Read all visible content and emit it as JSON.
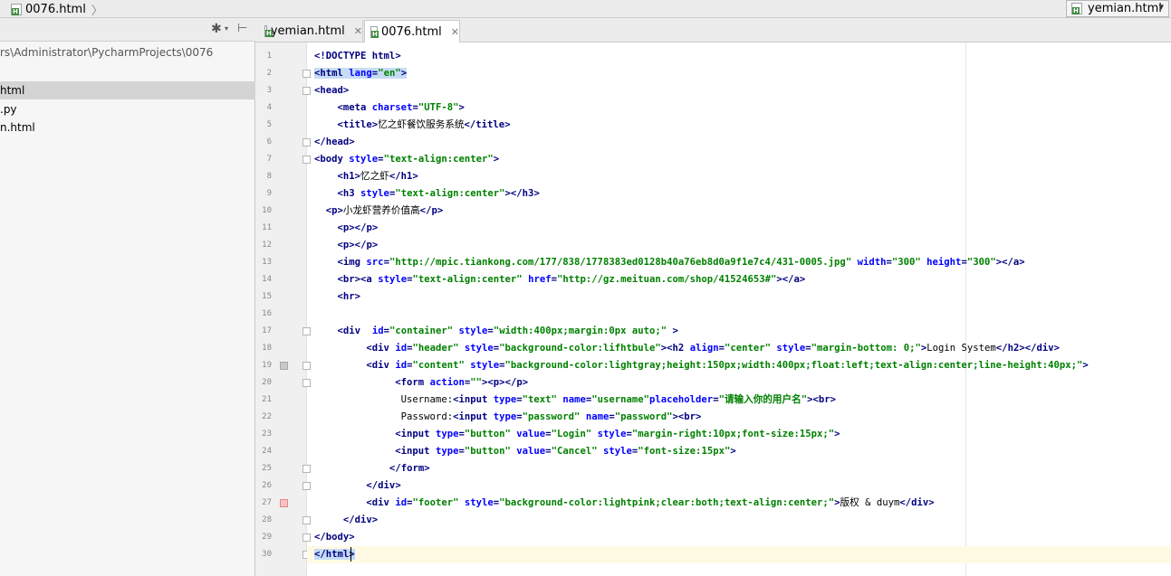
{
  "navbar": {
    "current_file": "0076.html",
    "run_config": "yemian.html"
  },
  "project": {
    "path": "rs\\Administrator\\PycharmProjects\\0076",
    "items": [
      {
        "label": "html",
        "selected": true
      },
      {
        "label": ".py",
        "selected": false
      },
      {
        "label": "n.html",
        "selected": false
      }
    ]
  },
  "tabs": [
    {
      "label": "yemian.html",
      "active": false
    },
    {
      "label": "0076.html",
      "active": true
    }
  ],
  "colors": {
    "tag": "#000080",
    "attr": "#0000ff",
    "string": "#008000",
    "current_line": "#fffae3",
    "match_highlight": "#c6dcf5"
  },
  "code": [
    {
      "n": "1",
      "text": "<!DOCTYPE html>"
    },
    {
      "n": "2",
      "text": "<html lang=\"en\">"
    },
    {
      "n": "3",
      "text": "<head>"
    },
    {
      "n": "4",
      "text": "    <meta charset=\"UTF-8\">"
    },
    {
      "n": "5",
      "text": "    <title>忆之虾餐饮服务系统</title>"
    },
    {
      "n": "6",
      "text": "</head>"
    },
    {
      "n": "7",
      "text": "<body style=\"text-align:center\">"
    },
    {
      "n": "8",
      "text": "    <h1>忆之虾</h1>"
    },
    {
      "n": "9",
      "text": "    <h3 style=\"text-align:center\"></h3>"
    },
    {
      "n": "10",
      "text": "  <p>小龙虾营养价值高</p>"
    },
    {
      "n": "11",
      "text": "    <p></p>"
    },
    {
      "n": "12",
      "text": "    <p></p>"
    },
    {
      "n": "13",
      "text": "    <img src=\"http://mpic.tiankong.com/177/838/1778383ed0128b40a76eb8d0a9f1e7c4/431-0005.jpg\" width=\"300\" height=\"300\"></a>"
    },
    {
      "n": "14",
      "text": "    <br><a style=\"text-align:center\" href=\"http://gz.meituan.com/shop/41524653#\"></a>"
    },
    {
      "n": "15",
      "text": "    <hr>"
    },
    {
      "n": "16",
      "text": ""
    },
    {
      "n": "17",
      "text": "    <div  id=\"container\" style=\"width:400px;margin:0px auto;\" >"
    },
    {
      "n": "18",
      "text": "         <div id=\"header\" style=\"background-color:lifhtbule\"><h2 align=\"center\" style=\"margin-bottom: 0;\">Login System</h2></div>"
    },
    {
      "n": "19",
      "text": "         <div id=\"content\" style=\"background-color:lightgray;height:150px;width:400px;float:left;text-align:center;line-height:40px;\">"
    },
    {
      "n": "20",
      "text": "              <form action=\"\"><p></p>"
    },
    {
      "n": "21",
      "text": "               Username:<input type=\"text\" name=\"username\"placeholder=\"请输入你的用户名\"><br>"
    },
    {
      "n": "22",
      "text": "               Password:<input type=\"password\" name=\"password\"><br>"
    },
    {
      "n": "23",
      "text": "              <input type=\"button\" value=\"Login\" style=\"margin-right:10px;font-size:15px;\">"
    },
    {
      "n": "24",
      "text": "              <input type=\"button\" value=\"Cancel\" style=\"font-size:15px\">"
    },
    {
      "n": "25",
      "text": "             </form>"
    },
    {
      "n": "26",
      "text": "         </div>"
    },
    {
      "n": "27",
      "text": "         <div id=\"footer\" style=\"background-color:lightpink;clear:both;text-align:center;\">版权 & duym</div>"
    },
    {
      "n": "28",
      "text": "     </div>"
    },
    {
      "n": "29",
      "text": "</body>"
    },
    {
      "n": "30",
      "text": "</html>"
    }
  ]
}
